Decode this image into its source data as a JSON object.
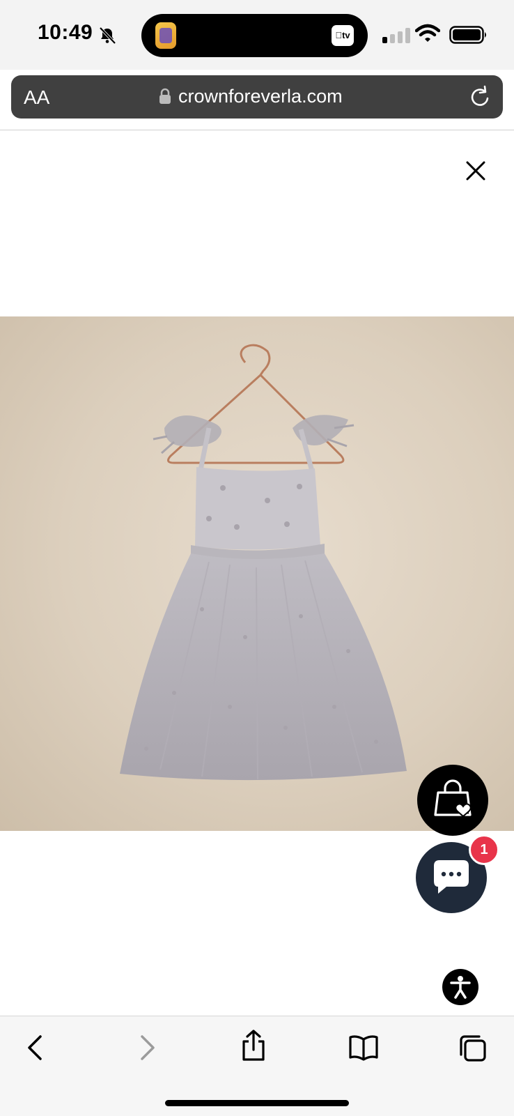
{
  "status_bar": {
    "time": "10:49",
    "island_app_icon": "MeeKoh game icon",
    "island_tv_label": "tv"
  },
  "url_bar": {
    "text_size_label": "AA",
    "url": "crownforeverla.com"
  },
  "modal": {
    "close_icon": "close-icon"
  },
  "product": {
    "image": "grey tulle dress with feather straps on copper hanger"
  },
  "floating_buttons": {
    "shop_icon": "shopping-bag-heart-icon",
    "chat_icon": "chat-bubble-icon",
    "chat_badge_count": "1",
    "accessibility_icon": "accessibility-icon"
  },
  "toolbar": {
    "icons": [
      "back-icon",
      "forward-icon",
      "share-icon",
      "bookmarks-icon",
      "tabs-icon"
    ]
  },
  "colors": {
    "url_bar_bg": "#404040",
    "chat_button_bg": "#1f2a3a",
    "badge_red": "#e8344a"
  }
}
